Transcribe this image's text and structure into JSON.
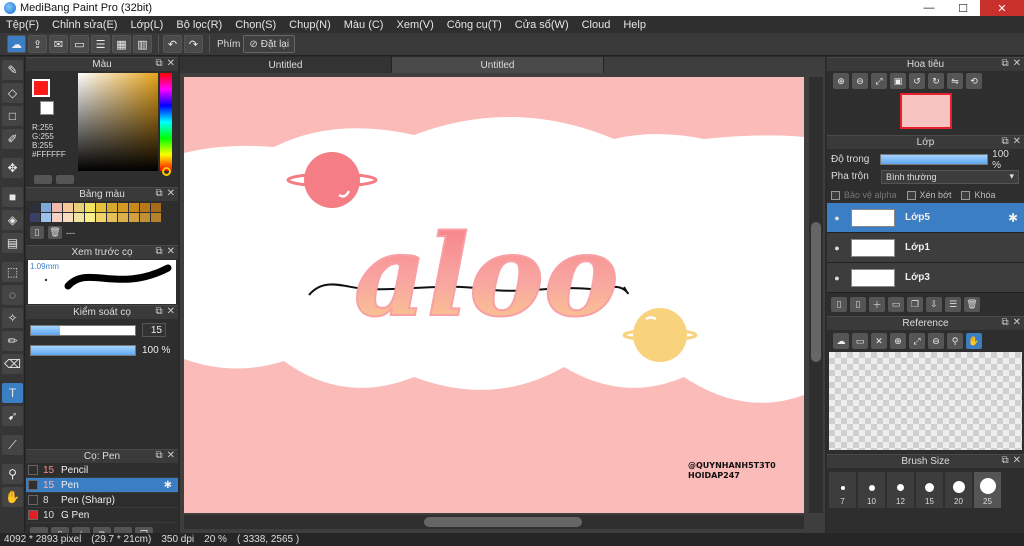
{
  "window": {
    "title": "MediBang Paint Pro (32bit)",
    "minimize": "—",
    "maximize": "☐",
    "close": "✕"
  },
  "menu": [
    "Tệp(F)",
    "Chỉnh sửa(E)",
    "Lớp(L)",
    "Bộ lọc(R)",
    "Chọn(S)",
    "Chụp(N)",
    "Màu (C)",
    "Xem(V)",
    "Công cụ(T)",
    "Cửa sổ(W)",
    "Cloud",
    "Help"
  ],
  "toolbar": {
    "shortcut_label": "Phím",
    "reset_label": "Đặt lại"
  },
  "color_panel": {
    "title": "Màu",
    "fg_color": "#FF1A1A",
    "r": "R:255",
    "g": "G:255",
    "b": "B:255",
    "hex": "#FFFFFF"
  },
  "palette_panel": {
    "title": "Bảng màu",
    "colors": [
      "#2a2f3a",
      "#7da8d8",
      "#f0b8a8",
      "#f5c89a",
      "#e8d07a",
      "#f2e35c",
      "#e6c23a",
      "#d4a92e",
      "#d49a22",
      "#c88a1c",
      "#b87818",
      "#a86a18",
      "#3a3f66",
      "#9cc2ec",
      "#f6d0c2",
      "#f8dcc0",
      "#f2e2a4",
      "#f7ee86",
      "#f0d46a",
      "#e6c058",
      "#dcb04a",
      "#d2a03e",
      "#c29034",
      "#b4822c"
    ],
    "extra_label": "---"
  },
  "brush_preview_panel": {
    "title": "Xem trước cọ",
    "size_label": "1.09mm"
  },
  "brush_control_panel": {
    "title": "Kiểm soát cọ",
    "size_value": "15",
    "size_fraction": 0.28,
    "opacity_value": "100 %",
    "opacity_fraction": 1.0
  },
  "brush_panel": {
    "title": "Cọ: Pen",
    "items": [
      {
        "size": "15",
        "name": "Pencil",
        "color": "#2f2f2f",
        "selected": false
      },
      {
        "size": "15",
        "name": "Pen",
        "color": "#2f2f2f",
        "selected": true
      },
      {
        "size": "8",
        "name": "Pen (Sharp)",
        "color": "#2f2f2f",
        "selected": false
      },
      {
        "size": "10",
        "name": "G Pen",
        "color": "#e02020",
        "selected": false
      }
    ]
  },
  "tabs": [
    "Untitled",
    "Untitled"
  ],
  "artwork": {
    "text": "aloo",
    "signature_line1": "@QUYNHANH5T3T0",
    "signature_line2": "HOIDAP247"
  },
  "navigator_panel": {
    "title": "Hoa tiêu"
  },
  "layer_panel": {
    "title": "Lớp",
    "opacity_label": "Độ trong",
    "opacity_value": "100 %",
    "blend_label": "Pha trộn",
    "blend_value": "Bình thường",
    "protect_alpha": "Bảo vệ alpha",
    "clip": "Xén bớt",
    "lock": "Khóa",
    "layers": [
      {
        "name": "Lớp5",
        "selected": true
      },
      {
        "name": "Lớp1",
        "selected": false
      },
      {
        "name": "Lớp3",
        "selected": false
      }
    ]
  },
  "reference_panel": {
    "title": "Reference"
  },
  "brush_size_panel": {
    "title": "Brush Size",
    "sizes": [
      "7",
      "10",
      "12",
      "15",
      "20",
      "25"
    ]
  },
  "status": {
    "pixels": "4092 * 2893 pixel",
    "cm": "(29.7 * 21cm)",
    "dpi": "350 dpi",
    "zoom": "20 %",
    "coords": "( 3338, 2565 )"
  }
}
